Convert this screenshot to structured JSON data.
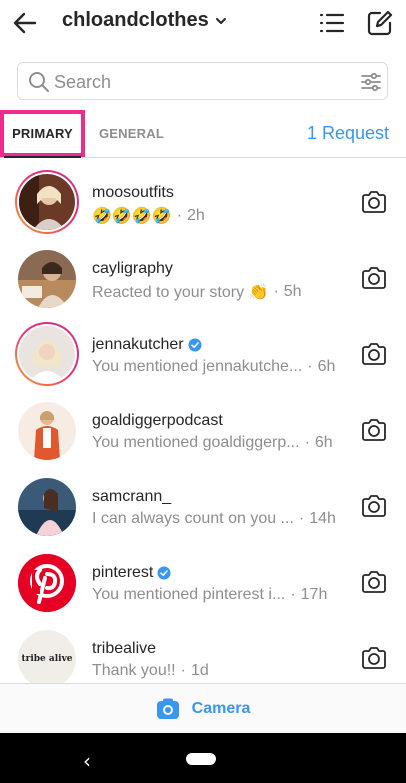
{
  "header": {
    "username": "chloandclothes",
    "back_icon": "arrow-left-icon",
    "chevron_icon": "chevron-down-icon",
    "list_icon": "list-icon",
    "compose_icon": "compose-icon"
  },
  "search": {
    "placeholder": "Search",
    "value": ""
  },
  "tabs": {
    "primary": "PRIMARY",
    "general": "GENERAL",
    "requests": "1 Request"
  },
  "colors": {
    "highlight": "#ec2c8f",
    "accent": "#3897f0",
    "secondary_text": "#8e8e8e"
  },
  "threads": [
    {
      "username": "moosoutfits",
      "verified": false,
      "preview": "🤣🤣🤣🤣",
      "time": "2h",
      "story_ring": true
    },
    {
      "username": "cayligraphy",
      "verified": false,
      "preview": "Reacted to your story 👏",
      "time": "5h",
      "story_ring": false
    },
    {
      "username": "jennakutcher",
      "verified": true,
      "preview": "You mentioned jennakutche...",
      "time": "6h",
      "story_ring": true
    },
    {
      "username": "goaldiggerpodcast",
      "verified": false,
      "preview": "You mentioned goaldiggerp...",
      "time": "6h",
      "story_ring": false
    },
    {
      "username": "samcrann_",
      "verified": false,
      "preview": "I can always count on you ...",
      "time": "14h",
      "story_ring": false
    },
    {
      "username": "pinterest",
      "verified": true,
      "preview": "You mentioned pinterest i...",
      "time": "17h",
      "story_ring": false
    },
    {
      "username": "tribealive",
      "verified": false,
      "preview": "Thank you!!",
      "time": "1d",
      "story_ring": false,
      "avatar_text": "tribe alive"
    }
  ],
  "bottom": {
    "camera_label": "Camera",
    "camera_icon": "camera-icon"
  },
  "system_nav": {
    "back_glyph": "‹"
  }
}
